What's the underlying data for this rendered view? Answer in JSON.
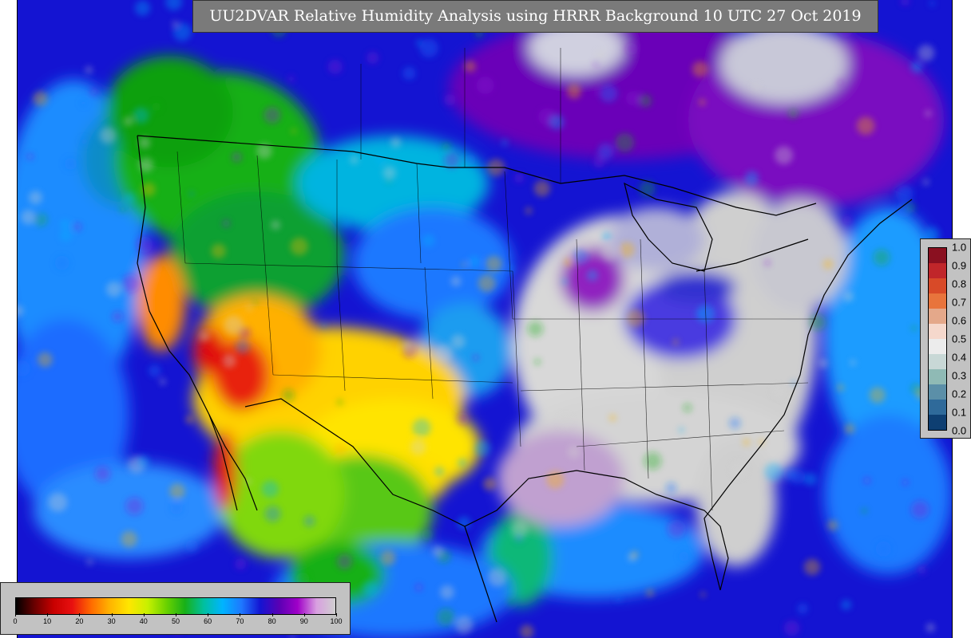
{
  "title": "UU2DVAR Relative Humidity Analysis using HRRR Background 10 UTC 27 Oct 2019",
  "rh_colorbar": {
    "ticks": [
      "0",
      "10",
      "20",
      "30",
      "40",
      "50",
      "60",
      "70",
      "80",
      "90",
      "100"
    ],
    "min": 0,
    "max": 100,
    "colors": [
      "#000000",
      "#6b0000",
      "#c80000",
      "#e81010",
      "#ff6a00",
      "#ffb400",
      "#ffe600",
      "#c8f000",
      "#6ad200",
      "#18b018",
      "#00c0a0",
      "#00b4ff",
      "#1e78ff",
      "#1414d2",
      "#5a00b4",
      "#a000c8",
      "#d8a0e0",
      "#d0d0d0"
    ]
  },
  "increment_colorbar": {
    "ticks": [
      "1.0",
      "0.9",
      "0.8",
      "0.7",
      "0.6",
      "0.5",
      "0.4",
      "0.3",
      "0.2",
      "0.1",
      "0.0"
    ],
    "colors": [
      "#0e3f72",
      "#2f6a9a",
      "#5b8fa8",
      "#8fbab5",
      "#c8d8d6",
      "#ececec",
      "#f5d8cc",
      "#e4a88a",
      "#e8743c",
      "#d84a28",
      "#c0262a",
      "#8a1020"
    ]
  },
  "map": {
    "background_color": "#1414d2",
    "ocean_color": "#1e6cff",
    "dry_color": "#ffd200",
    "moist_color": "#d6d6d6"
  }
}
